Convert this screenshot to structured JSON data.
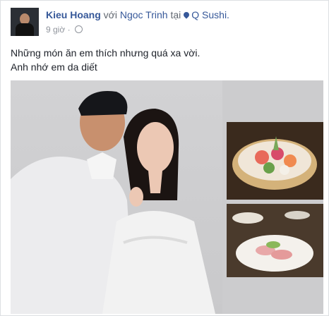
{
  "post": {
    "author": "Kieu Hoang",
    "with_word": "với",
    "tagged_person": "Ngoc Trinh",
    "at_word": "tại",
    "location": "Q Sushi.",
    "time": "9 giờ",
    "separator": "·",
    "privacy_icon": "globe-icon",
    "text_line1": "Những món ăn em thích nhưng quá xa vời.",
    "text_line2": "Anh nhớ em da diết"
  },
  "colors": {
    "link": "#365899",
    "text": "#1d2129",
    "meta": "#90949c"
  }
}
